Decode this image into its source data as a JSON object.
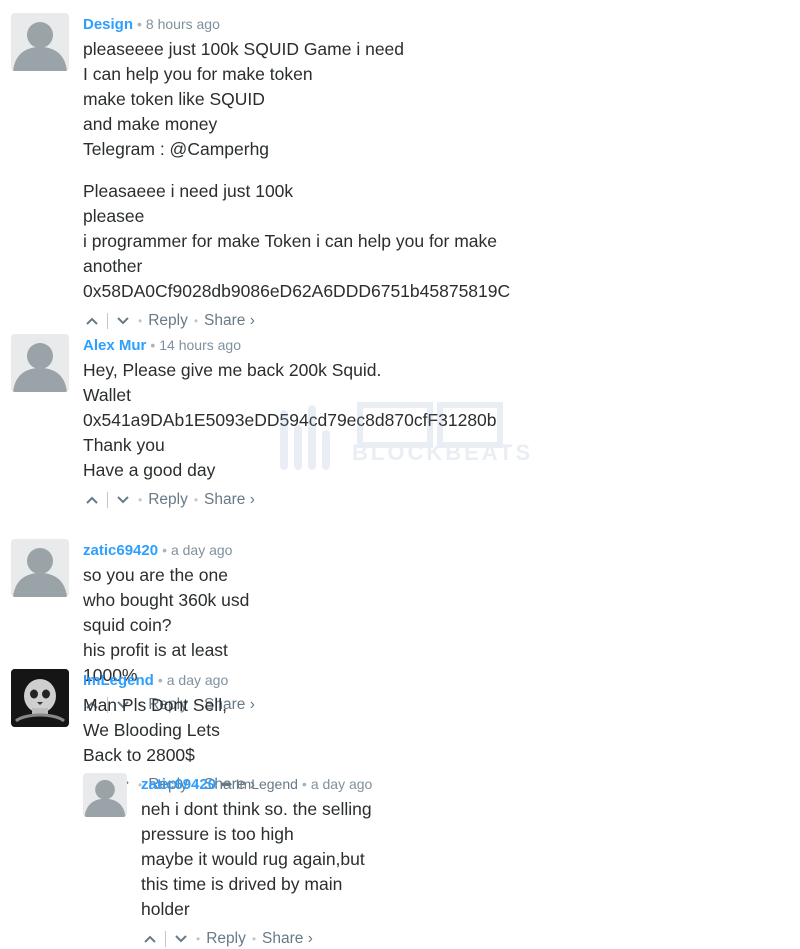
{
  "comments": [
    {
      "author": "Design",
      "time": "8 hours ago",
      "paragraphs": [
        [
          "pleaseeee just 100k SQUID Game i need",
          "I can help you for make token",
          "make token like SQUID",
          "and make money",
          "Telegram : @Camperhg"
        ],
        [
          "Pleasaeee i need just 100k",
          "pleasee",
          "i programmer for make Token i can help you for make another",
          "0x58DA0Cf9028db9086eD62A6DDD6751b45875819C"
        ]
      ],
      "actions": {
        "reply": "Reply",
        "share": "Share ›"
      }
    },
    {
      "author": "Alex Mur",
      "time": "14 hours ago",
      "paragraphs": [
        [
          "Hey, Please give me back 200k Squid.",
          "Wallet",
          "0x541a9DAb1E5093eDD594cd79ec8d870cfF31280b",
          "Thank you",
          "Have a good day"
        ]
      ],
      "actions": {
        "reply": "Reply",
        "share": "Share ›"
      }
    },
    {
      "author": "zatic69420",
      "time": "a day ago",
      "paragraphs": [
        [
          "so you are the one who bought 360k usd squid coin?",
          "his profit is at least 1000%"
        ]
      ],
      "actions": {
        "reply": "Reply",
        "share": "Share ›"
      }
    },
    {
      "author": "ImLegend",
      "time": "a day ago",
      "paragraphs": [
        [
          "Man Pls Dont Sell, We Blooding Lets Back to 2800$"
        ]
      ],
      "actions": {
        "reply": "Reply",
        "share": "Share ›"
      }
    },
    {
      "author": "zatic69420",
      "reply_to": "ImLegend",
      "time": "a day ago",
      "paragraphs": [
        [
          "neh i dont think so. the selling pressure is too high",
          "maybe it would rug again,but this time is drived by main holder"
        ]
      ],
      "actions": {
        "reply": "Reply",
        "share": "Share ›"
      }
    }
  ],
  "watermark": {
    "text": "BLOCKBEATS"
  },
  "colors": {
    "author": "#2e9fff",
    "meta": "#7f919e",
    "text": "#2a2e2e",
    "actions": "#687a86"
  }
}
